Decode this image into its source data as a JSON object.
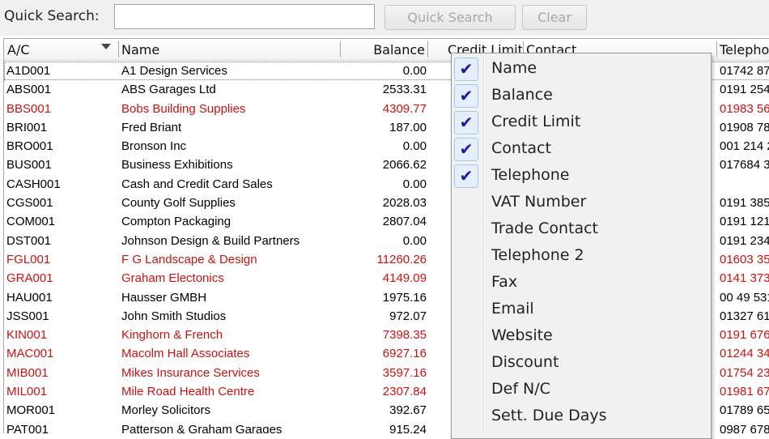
{
  "quick_search": {
    "label": "Quick Search:",
    "input_value": "",
    "button_label": "Quick Search",
    "clear_label": "Clear"
  },
  "columns": {
    "ac": "A/C",
    "name": "Name",
    "balance": "Balance",
    "credit_limit": "Credit Limit",
    "contact": "Contact",
    "telephone": "Telepho"
  },
  "rows": [
    {
      "ac": "A1D001",
      "name": "A1 Design Services",
      "balance": "0.00",
      "tel": "01742 87",
      "red": false
    },
    {
      "ac": "ABS001",
      "name": "ABS Garages Ltd",
      "balance": "2533.31",
      "tel": "0191 254",
      "red": false
    },
    {
      "ac": "BBS001",
      "name": "Bobs Building Supplies",
      "balance": "4309.77",
      "tel": "01983 56",
      "red": true
    },
    {
      "ac": "BRI001",
      "name": "Fred Briant",
      "balance": "187.00",
      "tel": "01908 78",
      "red": false
    },
    {
      "ac": "BRO001",
      "name": "Bronson Inc",
      "balance": "0.00",
      "tel": "001 214 2",
      "red": false
    },
    {
      "ac": "BUS001",
      "name": "Business Exhibitions",
      "balance": "2066.62",
      "tel": "017684 3",
      "red": false
    },
    {
      "ac": "CASH001",
      "name": "Cash and Credit Card Sales",
      "balance": "0.00",
      "tel": "",
      "red": false
    },
    {
      "ac": "CGS001",
      "name": "County Golf Supplies",
      "balance": "2028.03",
      "tel": "0191 385",
      "red": false
    },
    {
      "ac": "COM001",
      "name": "Compton Packaging",
      "balance": "2807.04",
      "tel": "0191 121",
      "red": false
    },
    {
      "ac": "DST001",
      "name": "Johnson Design & Build Partners",
      "balance": "0.00",
      "tel": "0191 234",
      "red": false
    },
    {
      "ac": "FGL001",
      "name": "F G Landscape & Design",
      "balance": "11260.26",
      "tel": "01603 35",
      "red": true
    },
    {
      "ac": "GRA001",
      "name": "Graham Electonics",
      "balance": "4149.09",
      "tel": "0141 373",
      "red": true
    },
    {
      "ac": "HAU001",
      "name": "Hausser GMBH",
      "balance": "1975.16",
      "tel": "00 49 531",
      "red": false
    },
    {
      "ac": "JSS001",
      "name": "John Smith Studios",
      "balance": "972.07",
      "tel": "01327 61",
      "red": false
    },
    {
      "ac": "KIN001",
      "name": "Kinghorn & French",
      "balance": "7398.35",
      "tel": "0191 676",
      "red": true
    },
    {
      "ac": "MAC001",
      "name": "Macolm Hall Associates",
      "balance": "6927.16",
      "tel": "01244 34",
      "red": true
    },
    {
      "ac": "MIB001",
      "name": "Mikes Insurance Services",
      "balance": "3597.16",
      "tel": "01754 23",
      "red": true
    },
    {
      "ac": "MIL001",
      "name": "Mile Road Health Centre",
      "balance": "2307.84",
      "tel": "01981 67",
      "red": true
    },
    {
      "ac": "MOR001",
      "name": "Morley Solicitors",
      "balance": "392.67",
      "tel": "01789 65",
      "red": false
    },
    {
      "ac": "PAT001",
      "name": "Patterson & Graham Garages",
      "balance": "915.24",
      "tel": "0987 678",
      "red": false
    }
  ],
  "column_menu": [
    {
      "label": "Name",
      "checked": true
    },
    {
      "label": "Balance",
      "checked": true
    },
    {
      "label": "Credit Limit",
      "checked": true
    },
    {
      "label": "Contact",
      "checked": true
    },
    {
      "label": "Telephone",
      "checked": true
    },
    {
      "label": "VAT Number",
      "checked": false
    },
    {
      "label": "Trade Contact",
      "checked": false
    },
    {
      "label": "Telephone 2",
      "checked": false
    },
    {
      "label": "Fax",
      "checked": false
    },
    {
      "label": "Email",
      "checked": false
    },
    {
      "label": "Website",
      "checked": false
    },
    {
      "label": "Discount",
      "checked": false
    },
    {
      "label": "Def N/C",
      "checked": false
    },
    {
      "label": "Sett. Due Days",
      "checked": false
    }
  ],
  "colors": {
    "overdue_text": "#cc1111",
    "check_mark": "#1a1aa0"
  },
  "icons": {
    "sort": "sort-descending-icon",
    "check": "checkmark-icon"
  }
}
